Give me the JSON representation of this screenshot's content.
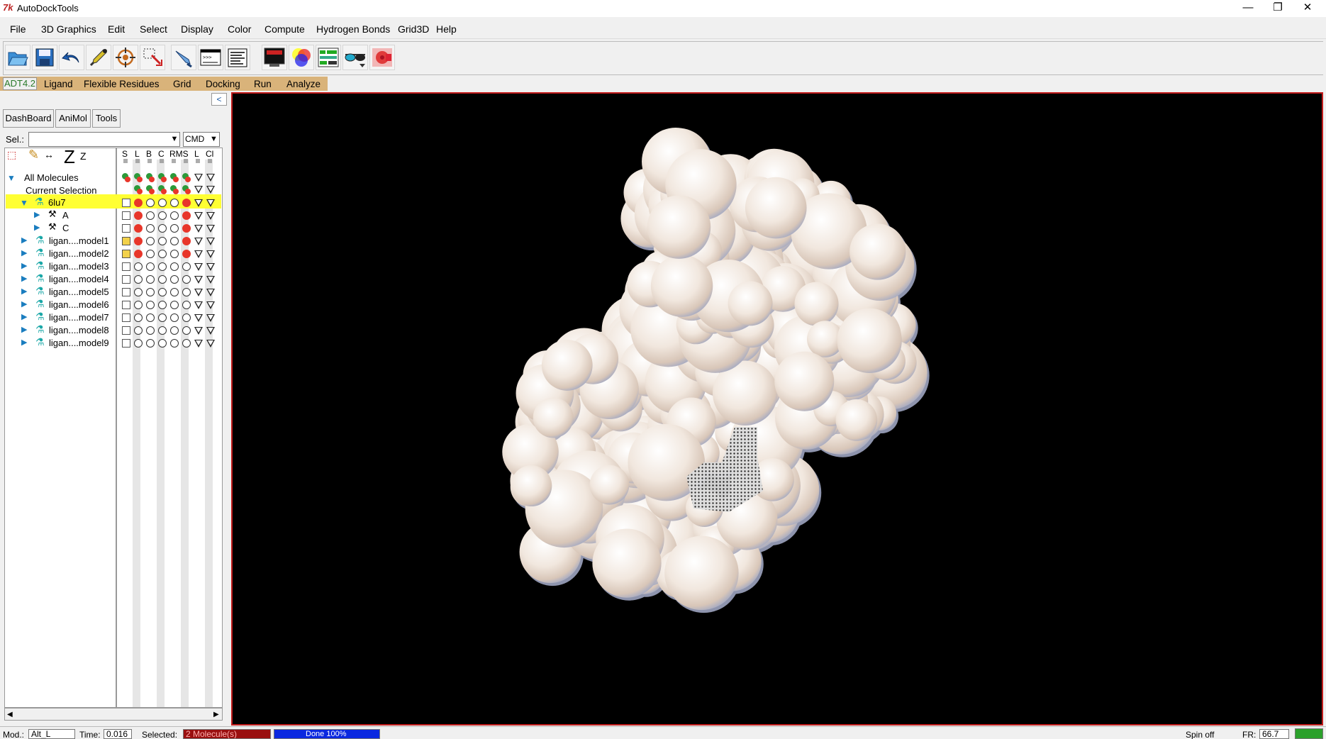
{
  "window": {
    "app_icon": "7k",
    "title": "AutoDockTools",
    "minimize": "—",
    "restore": "❐",
    "close": "✕"
  },
  "menu": [
    "File",
    "3D Graphics",
    "Edit",
    "Select",
    "Display",
    "Color",
    "Compute",
    "Hydrogen Bonds",
    "Grid3D",
    "Help"
  ],
  "toolbar_icons": [
    "open-folder-icon",
    "save-disk-icon",
    "undo-arrow-icon",
    "dropper-icon",
    "target-icon",
    "select-box-icon",
    "hand-pick-icon",
    "python-shell-icon",
    "text-list-icon",
    "monitor-icon",
    "color-wheel-icon",
    "dashboard-icon",
    "stereo-glasses-icon",
    "movie-icon"
  ],
  "module_tabs": {
    "active": "ADT4.2",
    "items": [
      "Ligand",
      "Flexible Residues",
      "Grid",
      "Docking",
      "Run",
      "Analyze"
    ]
  },
  "notebook_tabs": [
    "DashBoard",
    "AniMol",
    "Tools"
  ],
  "selector": {
    "label": "Sel.:",
    "value": "",
    "cmd": "CMD"
  },
  "dashboard_tools": {
    "z_big": "Z",
    "z_small": "Z"
  },
  "columns": [
    "S",
    "L",
    "B",
    "C",
    "RMS",
    "L",
    "Cl"
  ],
  "tree": [
    {
      "label": "All Molecules",
      "level": 0
    },
    {
      "label": "Current Selection",
      "level": 1
    },
    {
      "label": "6lu7",
      "level": 1
    },
    {
      "label": "A",
      "level": 2
    },
    {
      "label": "C",
      "level": 2
    },
    {
      "label": "ligan....model1",
      "level": 1
    },
    {
      "label": "ligan....model2",
      "level": 1
    },
    {
      "label": "ligan....model3",
      "level": 1
    },
    {
      "label": "ligan....model4",
      "level": 1
    },
    {
      "label": "ligan....model5",
      "level": 1
    },
    {
      "label": "ligan....model6",
      "level": 1
    },
    {
      "label": "ligan....model7",
      "level": 1
    },
    {
      "label": "ligan....model8",
      "level": 1
    },
    {
      "label": "ligan....model9",
      "level": 1
    }
  ],
  "status": {
    "mod_label": "Mod.:",
    "mod_value": "Alt_L",
    "time_label": "Time:",
    "time_value": "0.016",
    "selected_label": "Selected:",
    "selected_value": "2 Molecule(s)",
    "progress_text": "Done 100%",
    "progress": 1.0,
    "spin": "Spin off",
    "fr_label": "FR:",
    "fr_value": "66.7"
  },
  "colors": {
    "accent_tab_bg": "#d9b37a",
    "highlight_row": "#ffff33",
    "viewer_border": "#c21d1d",
    "viewer_bg": "#000000",
    "progress": "#0a28e0",
    "selected_bg": "#9a0f0f"
  }
}
